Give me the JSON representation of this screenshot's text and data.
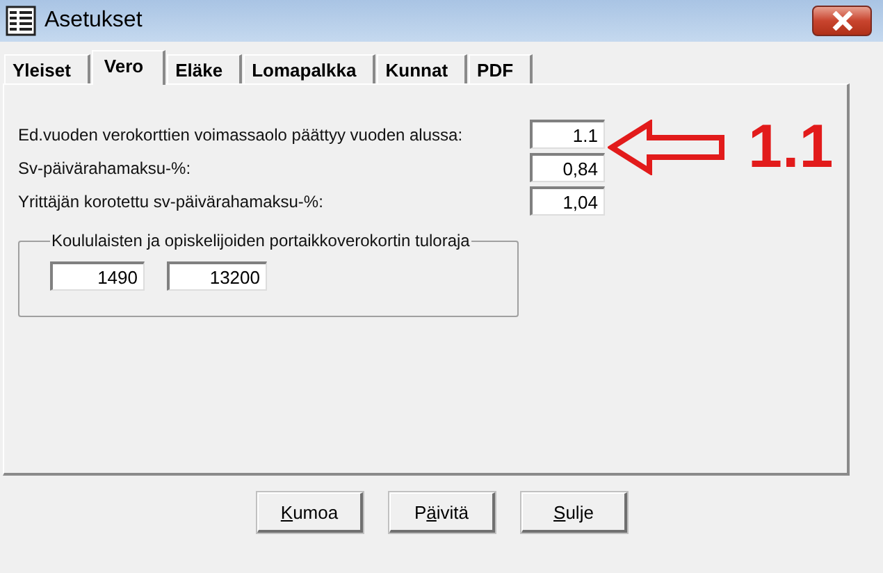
{
  "window": {
    "title": "Asetukset"
  },
  "tabs": [
    {
      "label": "Yleiset",
      "selected": false
    },
    {
      "label": "Vero",
      "selected": true
    },
    {
      "label": "Eläke",
      "selected": false
    },
    {
      "label": "Lomapalkka",
      "selected": false
    },
    {
      "label": "Kunnat",
      "selected": false
    },
    {
      "label": "PDF",
      "selected": false
    }
  ],
  "fields": [
    {
      "label": "Ed.vuoden verokorttien voimassaolo päättyy vuoden alussa:",
      "value": "1.1"
    },
    {
      "label": "Sv-päivärahamaksu-%:",
      "value": "0,84"
    },
    {
      "label": "Yrittäjän korotettu sv-päivärahamaksu-%:",
      "value": "1,04"
    }
  ],
  "group": {
    "title": "Koululaisten ja opiskelijoiden portaikkoverokortin tuloraja",
    "values": [
      "1490",
      "13200"
    ]
  },
  "annotation": {
    "text": "1.1"
  },
  "buttons": [
    {
      "key": "K",
      "after": "umoa"
    },
    {
      "before": "P",
      "key": "ä",
      "after": "ivitä"
    },
    {
      "key": "S",
      "after": "ulje"
    }
  ]
}
